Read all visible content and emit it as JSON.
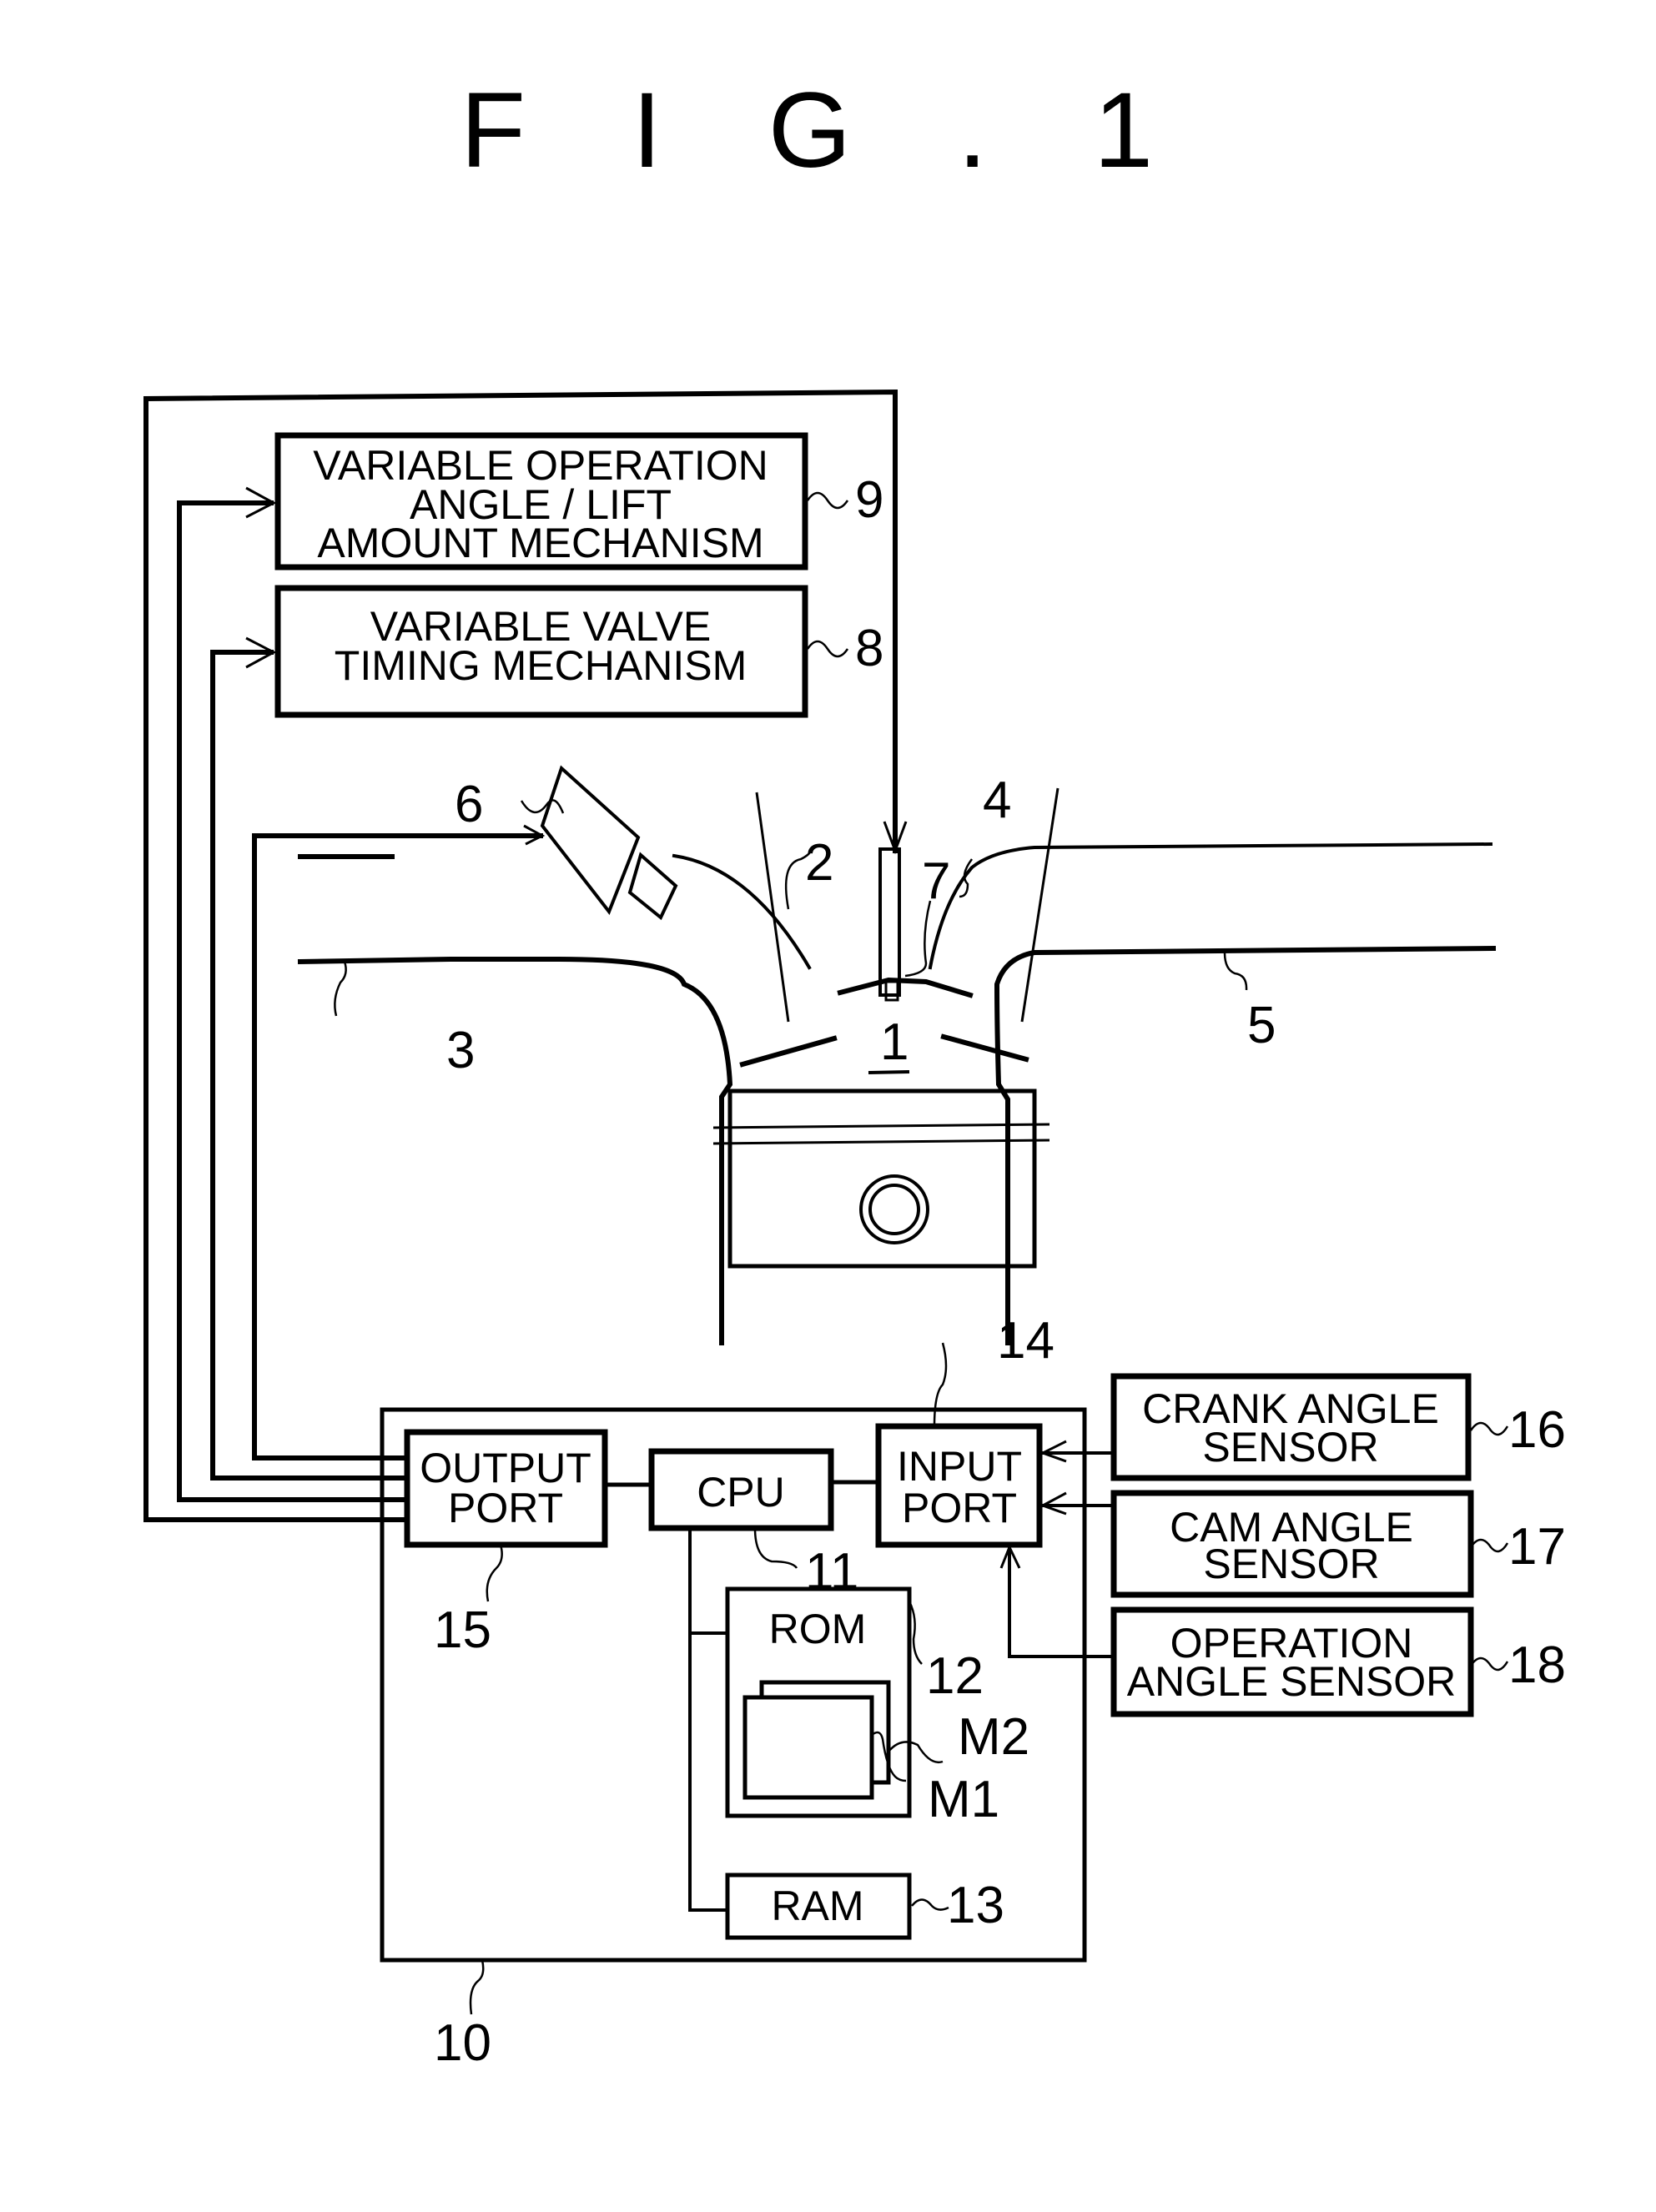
{
  "figure": {
    "title": "F I G . 1"
  },
  "components": {
    "mech9": {
      "lines": [
        "VARIABLE OPERATION",
        "ANGLE / LIFT",
        "AMOUNT MECHANISM"
      ],
      "ref": "9"
    },
    "mech8": {
      "lines": [
        "VARIABLE VALVE",
        "TIMING MECHANISM"
      ],
      "ref": "8"
    },
    "output_port": {
      "lines": [
        "OUTPUT",
        "PORT"
      ],
      "ref": "15"
    },
    "cpu": {
      "label": "CPU",
      "ref": "11"
    },
    "input_port": {
      "lines": [
        "INPUT",
        "PORT"
      ],
      "ref": "14"
    },
    "rom": {
      "label": "ROM",
      "ref": "12"
    },
    "ram": {
      "label": "RAM",
      "ref": "13"
    },
    "map_m1": {
      "ref": "M1"
    },
    "map_m2": {
      "ref": "M2"
    },
    "ecu": {
      "ref": "10"
    },
    "crank_sensor": {
      "lines": [
        "CRANK ANGLE",
        "SENSOR"
      ],
      "ref": "16"
    },
    "cam_sensor": {
      "lines": [
        "CAM ANGLE",
        "SENSOR"
      ],
      "ref": "17"
    },
    "op_angle_sensor": {
      "lines": [
        "OPERATION",
        "ANGLE SENSOR"
      ],
      "ref": "18"
    }
  },
  "engine_refs": {
    "engine": "1",
    "intake_valve": "2",
    "intake_port": "3",
    "exhaust_valve": "4",
    "exhaust_port": "5",
    "injector": "6",
    "spark_plug": "7"
  }
}
